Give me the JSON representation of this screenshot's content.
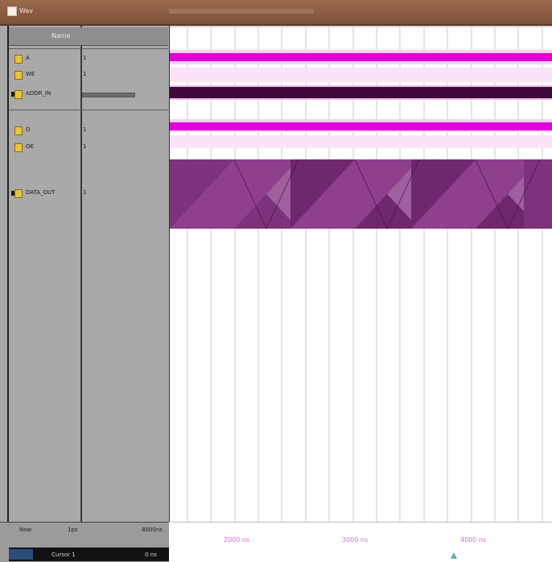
{
  "window": {
    "title": "Wav"
  },
  "header": {
    "name_col": "Name"
  },
  "signals": [
    {
      "name": "A",
      "value": "1"
    },
    {
      "name": "WE",
      "value": "1"
    },
    {
      "name": "ADDR_IN",
      "value": ""
    },
    {
      "name": "D",
      "value": "1"
    },
    {
      "name": "OE",
      "value": "1"
    },
    {
      "name": "DATA_OUT",
      "value": "1"
    }
  ],
  "footer": {
    "now_label": "Now",
    "now_value": "1ps",
    "time_value": "8000ns",
    "cursor_label": "Cursor 1",
    "cursor_time": "0 ns"
  },
  "timeline": {
    "ticks": [
      "2000 ns",
      "3000 ns",
      "4000 ns"
    ]
  },
  "colors": {
    "signal_magenta": "#e000d8",
    "bus_dark": "#3e0838",
    "bus_violet": "#7a2f78",
    "panel_gray": "#a9a9a9"
  }
}
